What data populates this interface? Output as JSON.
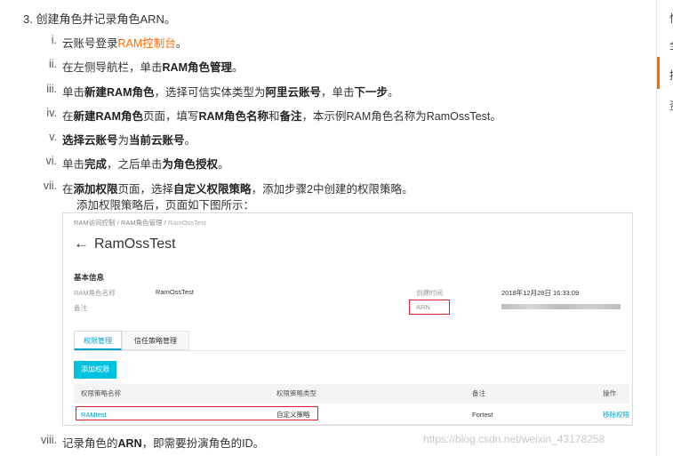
{
  "doc": {
    "step_title": "3. 创建角色并记录角色ARN。",
    "steps": {
      "s1": {
        "num": "i.",
        "prefix": "云账号登录",
        "link": "RAM控制台",
        "suffix": "。"
      },
      "s2": {
        "num": "ii.",
        "t1": "在左侧导航栏，单击",
        "b1": "RAM角色管理",
        "t2": "。"
      },
      "s3": {
        "num": "iii.",
        "t1": "单击",
        "b1": "新建RAM角色",
        "t2": "，选择可信实体类型为",
        "b2": "阿里云账号",
        "t3": "，单击",
        "b3": "下一步",
        "t4": "。"
      },
      "s4": {
        "num": "iv.",
        "t1": "在",
        "b1": "新建RAM角色",
        "t2": "页面，填写",
        "b2": "RAM角色名称",
        "t3": "和",
        "b3": "备注",
        "t4": "，本示例RAM角色名称为RamOssTest。"
      },
      "s5": {
        "num": "v.",
        "b1": "选择云账号",
        "t1": "为",
        "b2": "当前云账号",
        "t2": "。"
      },
      "s6": {
        "num": "vi.",
        "t1": "单击",
        "b1": "完成",
        "t2": "，之后单击",
        "b2": "为角色授权",
        "t3": "。"
      },
      "s7": {
        "num": "vii.",
        "t1": "在",
        "b1": "添加权限",
        "t2": "页面，选择",
        "b2": "自定义权限策略",
        "t3": "，添加步骤2中创建的权限策略。"
      },
      "s7_line2": "添加权限策略后，页面如下图所示：",
      "s8": {
        "num": "viii.",
        "t1": "记录角色的",
        "b1": "ARN",
        "t2": "，即需要扮演角色的ID。"
      }
    }
  },
  "console": {
    "breadcrumb": {
      "a": "RAM访问控制",
      "sep": "/",
      "b": "RAM角色管理",
      "c": "RamOssTest"
    },
    "back_arrow": "←",
    "title": "RamOssTest",
    "section": "基本信息",
    "fields": {
      "role_name_label": "RAM角色名称",
      "role_name_value": "RamOssTest",
      "remark_label": "备注",
      "created_label": "创建时间",
      "created_value": "2018年12月28日 16:33:09",
      "arn_label": "ARN"
    },
    "tabs": {
      "active": "权限管理",
      "inactive": "信任策略管理"
    },
    "add_button": "添加权限",
    "table": {
      "headers": {
        "name": "权限策略名称",
        "type": "权限策略类型",
        "remark": "备注",
        "ops": "操作"
      },
      "row": {
        "name": "RAMtest",
        "type": "自定义策略",
        "remark": "Fortest",
        "op": "移除权限"
      }
    }
  },
  "rail": {
    "c1": "快",
    "c2": "全",
    "c3": "控",
    "c4": "资"
  },
  "watermark": "https://blog.csdn.net/weixin_43178258",
  "colors": {
    "accent_orange": "#ff6a00",
    "console_blue": "#00a2ca",
    "button_cyan": "#00c1de",
    "highlight_red": "#d9252b"
  }
}
